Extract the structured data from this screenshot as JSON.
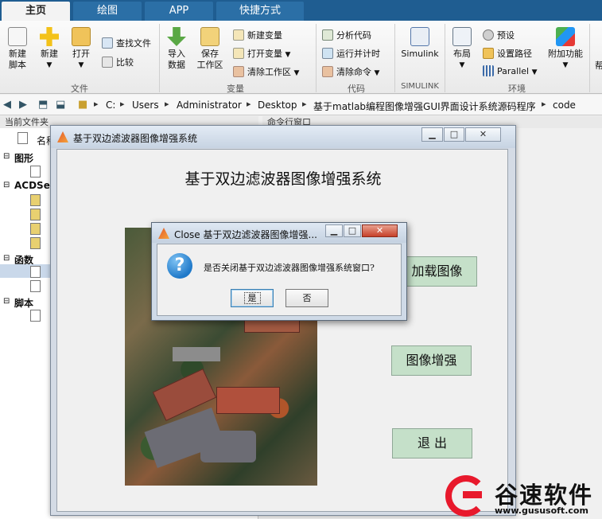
{
  "tabs": [
    {
      "label": "主页",
      "active": true
    },
    {
      "label": "绘图",
      "active": false
    },
    {
      "label": "APP",
      "active": false
    },
    {
      "label": "快捷方式",
      "active": false
    }
  ],
  "toolstrip": {
    "file": {
      "new_script": "新建\n脚本",
      "new": "新建",
      "open": "打开",
      "find_files": "查找文件",
      "compare": "比较",
      "section": "文件"
    },
    "variable": {
      "import_data": "导入\n数据",
      "save_workspace": "保存\n工作区",
      "new_variable": "新建变量",
      "open_variable": "打开变量",
      "clear_workspace": "清除工作区",
      "section": "变量"
    },
    "code": {
      "analyze_code": "分析代码",
      "run_and_time": "运行并计时",
      "clear_commands": "清除命令",
      "section": "代码"
    },
    "simulink": {
      "label": "Simulink",
      "section": "SIMULINK"
    },
    "environment": {
      "layout": "布局",
      "preferences": "预设",
      "set_path": "设置路径",
      "parallel": "Parallel",
      "addons": "附加功能",
      "section": "环境"
    },
    "truncated": "帮"
  },
  "address": {
    "path": [
      "C:",
      "Users",
      "Administrator",
      "Desktop",
      "基于matlab编程图像增强GUI界面设计系统源码程序",
      "code"
    ]
  },
  "file_panel": {
    "header": "当前文件夹",
    "column_name": "名称",
    "groups": [
      "图形",
      "ACDSee",
      "函数",
      "脚本"
    ]
  },
  "command_panel": {
    "header": "命令行窗口"
  },
  "figure": {
    "window_title": "基于双边滤波器图像增强系统",
    "heading": "基于双边滤波器图像增强系统",
    "load_button": "加载图像",
    "enhance_button": "图像增强",
    "exit_button": "退 出"
  },
  "dialog": {
    "title": "Close 基于双边滤波器图像增强...",
    "message": "是否关闭基于双边滤波器图像增强系统窗口?",
    "yes": "是",
    "no": "否"
  },
  "watermark": {
    "brand": "谷速软件",
    "url": "www.gususoft.com"
  },
  "colors": {
    "tab_bar": "#1f5d91",
    "button_green": "#c5e0c9",
    "question_blue": "#1f79c9",
    "watermark_red": "#e8192c"
  }
}
